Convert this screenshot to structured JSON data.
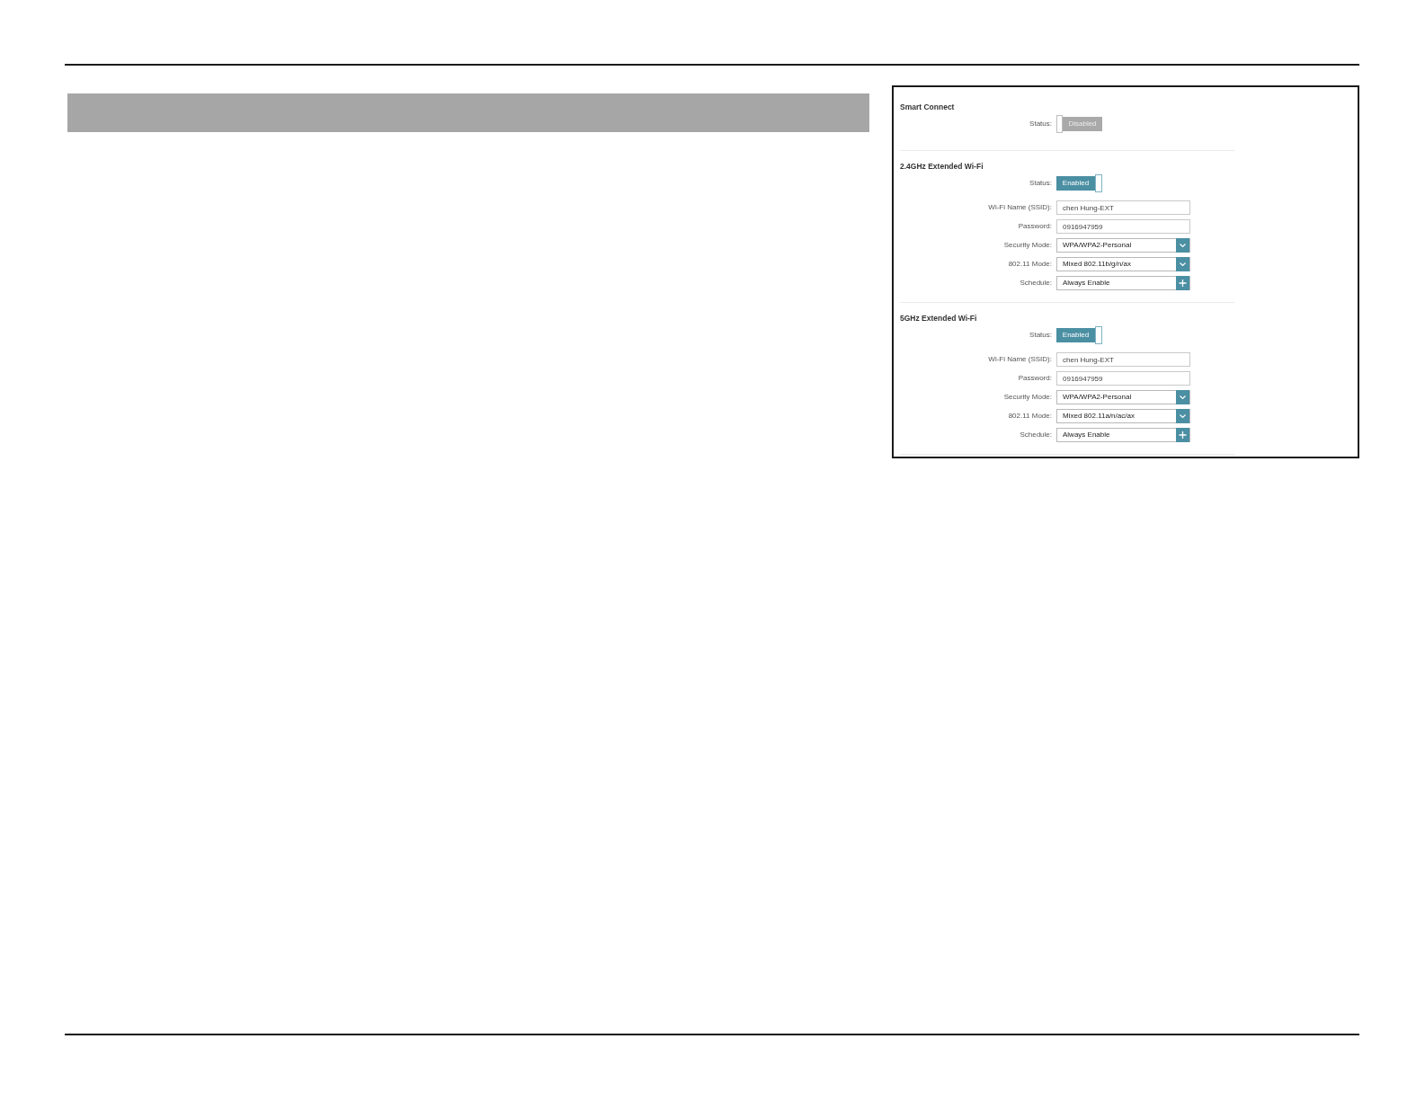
{
  "settings_panel": {
    "sections": [
      {
        "title": "Smart Connect",
        "fields": [
          {
            "kind": "toggle",
            "label": "Status:",
            "on": false,
            "value": "Disabled"
          }
        ]
      },
      {
        "title": "2.4GHz Extended Wi-Fi",
        "fields": [
          {
            "kind": "toggle",
            "label": "Status:",
            "on": true,
            "value": "Enabled"
          },
          {
            "kind": "text",
            "label": "Wi-Fi Name (SSID):",
            "value": "chen Hung-EXT"
          },
          {
            "kind": "text",
            "label": "Password:",
            "value": "0916947959"
          },
          {
            "kind": "select",
            "label": "Security Mode:",
            "value": "WPA/WPA2-Personal"
          },
          {
            "kind": "select",
            "label": "802.11 Mode:",
            "value": "Mixed 802.11b/g/n/ax"
          },
          {
            "kind": "schedule",
            "label": "Schedule:",
            "value": "Always Enable"
          }
        ]
      },
      {
        "title": "5GHz Extended Wi-Fi",
        "fields": [
          {
            "kind": "toggle",
            "label": "Status:",
            "on": true,
            "value": "Enabled"
          },
          {
            "kind": "text",
            "label": "Wi-Fi Name (SSID):",
            "value": "chen Hung-EXT"
          },
          {
            "kind": "text",
            "label": "Password:",
            "value": "0916947959"
          },
          {
            "kind": "select",
            "label": "Security Mode:",
            "value": "WPA/WPA2-Personal"
          },
          {
            "kind": "select",
            "label": "802.11 Mode:",
            "value": "Mixed 802.11a/n/ac/ax"
          },
          {
            "kind": "schedule",
            "label": "Schedule:",
            "value": "Always Enable"
          }
        ]
      }
    ]
  }
}
